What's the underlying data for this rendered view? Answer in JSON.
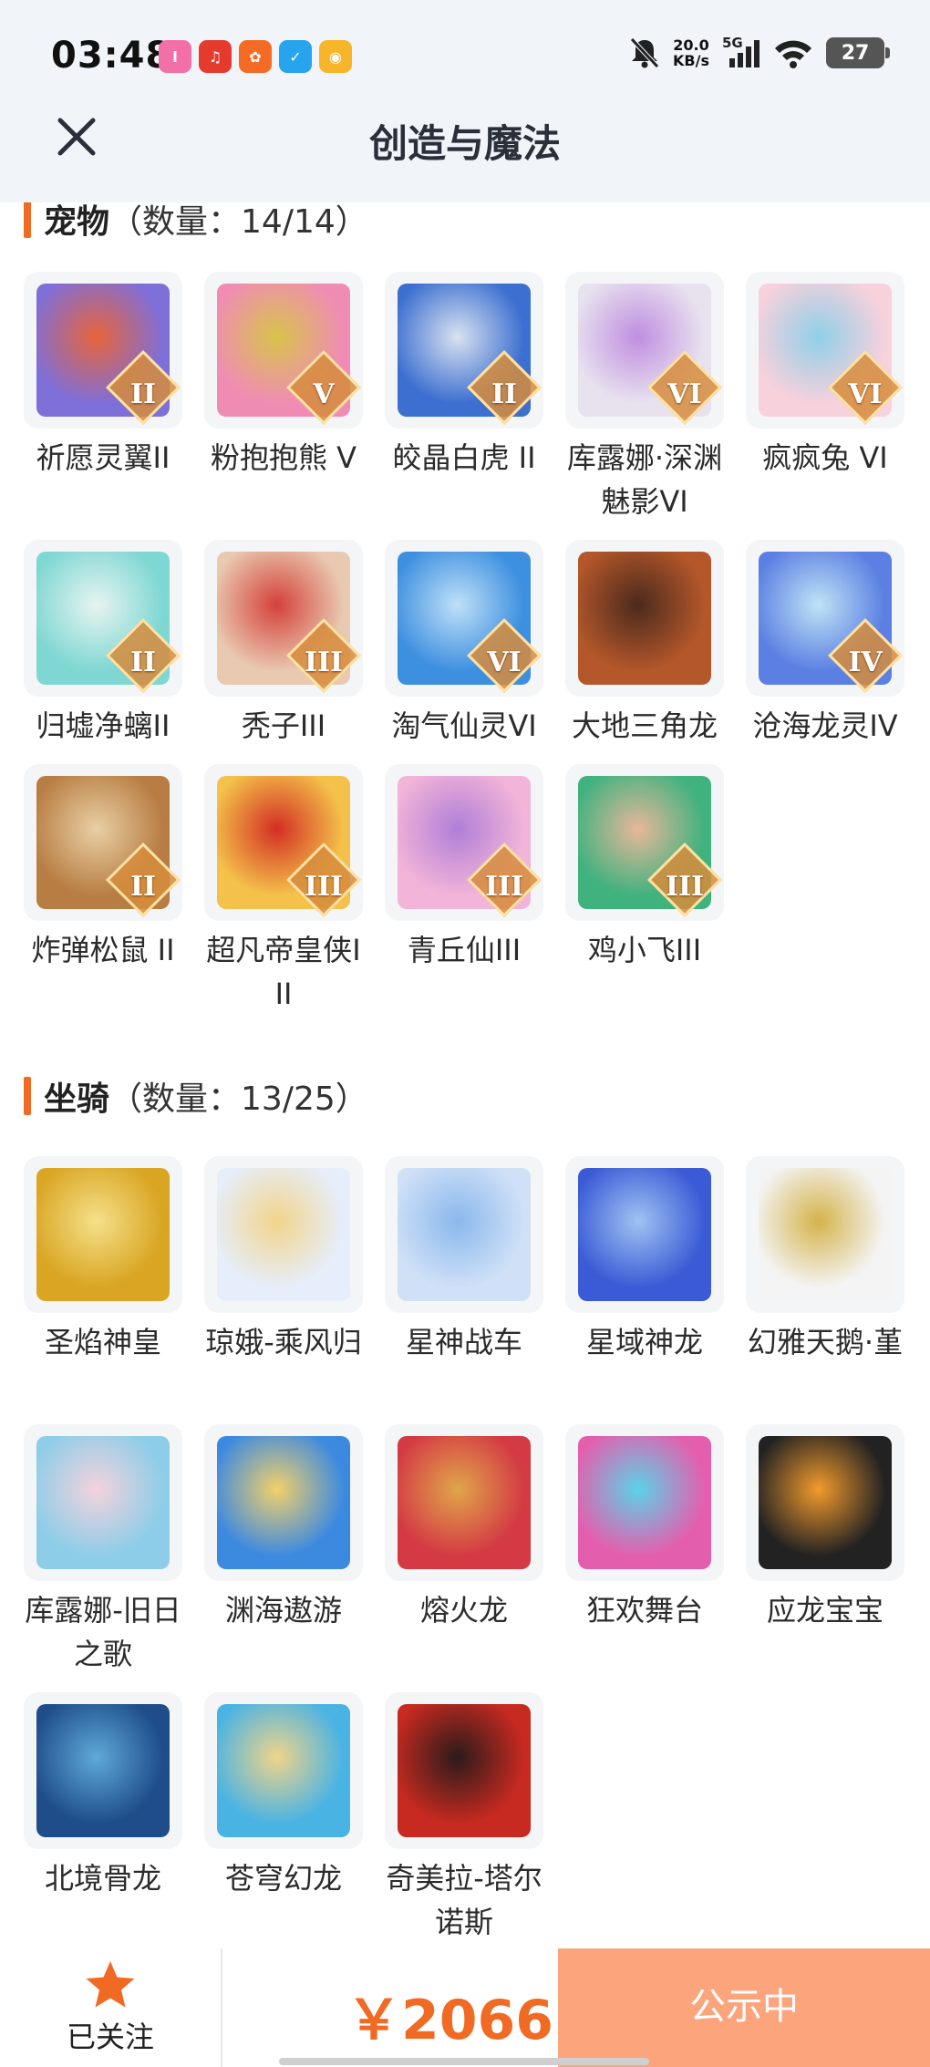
{
  "status_bar": {
    "time": "03:48",
    "net_speed_value": "20.0",
    "net_speed_unit": "KB/s",
    "network": "5G",
    "battery": "27",
    "app_icons": [
      {
        "icon": "lofter-icon",
        "color": "#f26fa8",
        "text": "l"
      },
      {
        "icon": "netease-music-icon",
        "color": "#e53a2e",
        "text": "♫"
      },
      {
        "icon": "app-grid-icon",
        "color": "#f46b25",
        "text": "✿"
      },
      {
        "icon": "check-app-icon",
        "color": "#27a4ee",
        "text": "✓"
      },
      {
        "icon": "weibo-icon",
        "color": "#f7b62a",
        "text": "◉"
      }
    ]
  },
  "header": {
    "title": "创造与魔法",
    "close_icon": "close-icon"
  },
  "pets": {
    "title": "宠物",
    "count": "（数量：14/14）",
    "items": [
      {
        "name": "祈愿灵翼II",
        "badge": "II",
        "colors": [
          "#7f6fd8",
          "#e7643a"
        ]
      },
      {
        "name": "粉抱抱熊 V",
        "badge": "V",
        "colors": [
          "#f08cb4",
          "#d8c34a"
        ]
      },
      {
        "name": "皎晶白虎 II",
        "badge": "II",
        "colors": [
          "#3c6fd0",
          "#d9e2ef"
        ]
      },
      {
        "name": "库露娜·深渊魅影VI",
        "badge": "VI",
        "colors": [
          "#e8e2ef",
          "#c08ee0"
        ]
      },
      {
        "name": "疯疯兔 VI",
        "badge": "VI",
        "colors": [
          "#f7d1dc",
          "#8fd0e8"
        ]
      },
      {
        "name": "归墟净螭II",
        "badge": "II",
        "colors": [
          "#7fd7d3",
          "#e7f4f1"
        ]
      },
      {
        "name": "秃子III",
        "badge": "III",
        "colors": [
          "#e9c9b0",
          "#d4413b"
        ]
      },
      {
        "name": "淘气仙灵VI",
        "badge": "VI",
        "colors": [
          "#3d8fe0",
          "#bfe0f7"
        ]
      },
      {
        "name": "大地三角龙",
        "badge": "",
        "colors": [
          "#b4572a",
          "#4b2a1d"
        ]
      },
      {
        "name": "沧海龙灵IV",
        "badge": "IV",
        "colors": [
          "#5b7fe2",
          "#bfe3f5"
        ]
      },
      {
        "name": "炸弹松鼠 II",
        "badge": "II",
        "colors": [
          "#b87d43",
          "#e8cfa4"
        ]
      },
      {
        "name": "超凡帝皇侠III",
        "badge": "III",
        "colors": [
          "#f4c24a",
          "#d32f24"
        ]
      },
      {
        "name": "青丘仙III",
        "badge": "III",
        "colors": [
          "#f2b4d8",
          "#b07ed8"
        ]
      },
      {
        "name": "鸡小飞III",
        "badge": "III",
        "colors": [
          "#3fb27e",
          "#e8b79a"
        ]
      }
    ]
  },
  "mounts": {
    "title": "坐骑",
    "count": "（数量：13/25）",
    "items": [
      {
        "name": "圣焰神皇",
        "badge": "",
        "colors": [
          "#d9a522",
          "#f5e08a"
        ]
      },
      {
        "name": "琼娥-乘风归",
        "badge": "",
        "colors": [
          "#e6eefb",
          "#f2d48a"
        ]
      },
      {
        "name": "星神战车",
        "badge": "",
        "colors": [
          "#cfe0f7",
          "#8ab8ec"
        ]
      },
      {
        "name": "星域神龙",
        "badge": "",
        "colors": [
          "#3b5bd6",
          "#9fc3f2"
        ]
      },
      {
        "name": "幻雅天鹅·堇",
        "badge": "",
        "colors": [
          "#f4f4f4",
          "#d5b34a"
        ]
      },
      {
        "name": "库露娜-旧日之歌",
        "badge": "",
        "colors": [
          "#8ecde8",
          "#f3d3dd"
        ]
      },
      {
        "name": "渊海遨游",
        "badge": "",
        "colors": [
          "#3c8ae0",
          "#f2d06a"
        ]
      },
      {
        "name": "熔火龙",
        "badge": "",
        "colors": [
          "#d43a44",
          "#e0a64a"
        ]
      },
      {
        "name": "狂欢舞台",
        "badge": "",
        "colors": [
          "#e35fae",
          "#5bd2e8"
        ]
      },
      {
        "name": "应龙宝宝",
        "badge": "",
        "colors": [
          "#222222",
          "#f29b2c"
        ]
      },
      {
        "name": "北境骨龙",
        "badge": "",
        "colors": [
          "#1e4d8a",
          "#5fa9d8"
        ]
      },
      {
        "name": "苍穹幻龙",
        "badge": "",
        "colors": [
          "#49b3e4",
          "#f0d488"
        ]
      },
      {
        "name": "奇美拉-塔尔诺斯",
        "badge": "",
        "colors": [
          "#c62a20",
          "#2b1b1b"
        ]
      }
    ]
  },
  "bottom_bar": {
    "follow_label": "已关注",
    "follow_icon": "star-icon",
    "price": "￥2066",
    "public_label": "公示中"
  },
  "colors": {
    "accent": "#f06a24",
    "button_bg": "#fca57c",
    "header_bg": "#f1f4f9"
  }
}
